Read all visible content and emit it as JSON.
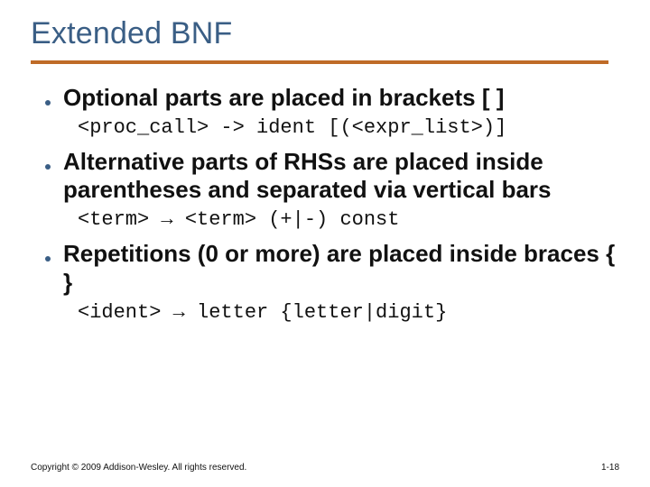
{
  "title": "Extended BNF",
  "bullets": [
    {
      "text": "Optional parts are placed in brackets [ ]",
      "code": "<proc_call> -> ident [(<expr_list>)]"
    },
    {
      "text": "Alternative parts of RHSs are placed inside parentheses and separated via vertical bars",
      "code": "<term> → <term> (+|-) const"
    },
    {
      "text": "Repetitions (0 or more) are placed inside braces { }",
      "code": "<ident> → letter {letter|digit}"
    }
  ],
  "footer": "Copyright © 2009 Addison-Wesley. All rights reserved.",
  "page_number": "1-18"
}
